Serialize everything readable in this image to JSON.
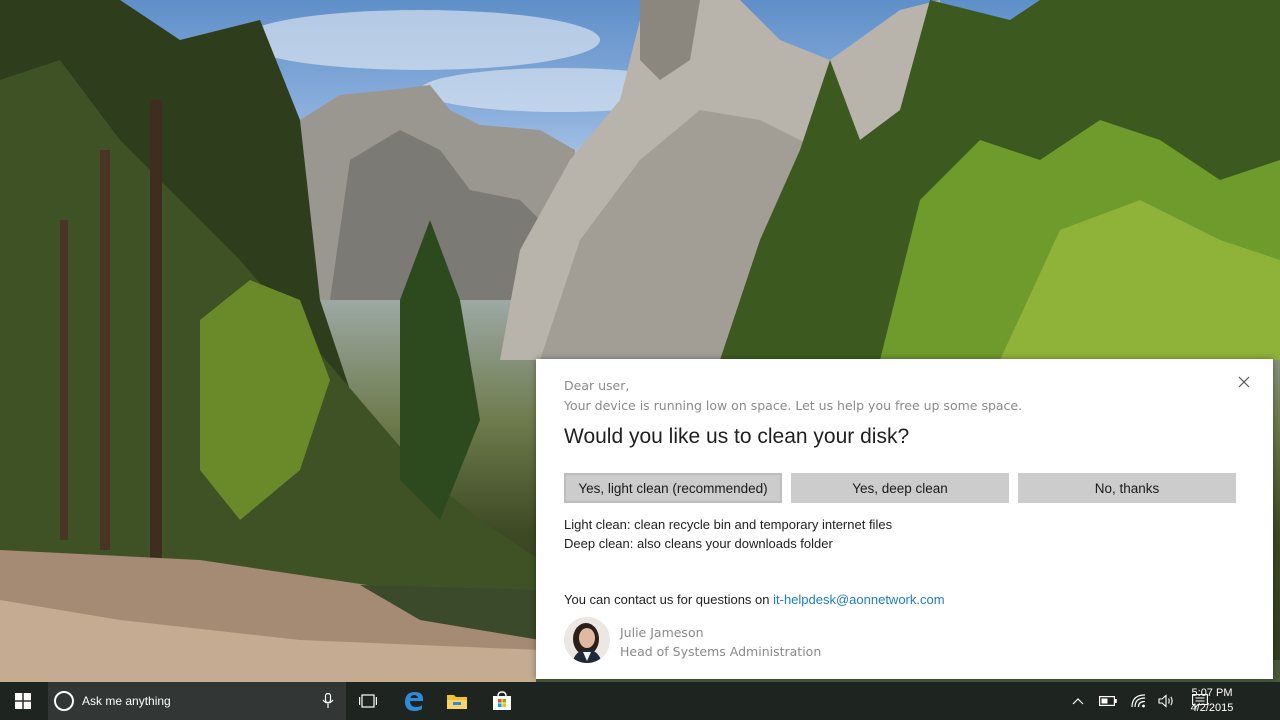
{
  "notification": {
    "greeting": "Dear user,",
    "subtext": "Your device is running low on space. Let us help you free up some space.",
    "question": "Would you like us to clean your disk?",
    "buttons": {
      "light": "Yes, light clean (recommended)",
      "deep": "Yes, deep clean",
      "no": "No, thanks"
    },
    "info_light": "Light clean: clean recycle bin and temporary internet files",
    "info_deep": "Deep clean: also cleans your downloads folder",
    "contact_prefix": "You can contact us for questions on ",
    "contact_email": "it-helpdesk@aonnetwork.com",
    "sender_name": "Julie Jameson",
    "sender_title": "Head of Systems Administration"
  },
  "taskbar": {
    "search_placeholder": "Ask me anything",
    "time": "5:07 PM",
    "date": "4/2/2015",
    "icons": [
      "windows-start-icon",
      "cortana-icon",
      "microphone-icon",
      "task-view-icon",
      "edge-browser-icon",
      "file-explorer-icon",
      "store-icon",
      "chevron-up-icon",
      "battery-icon",
      "wifi-icon",
      "volume-icon",
      "action-center-icon"
    ]
  },
  "colors": {
    "link": "#1e7cc8",
    "taskbar": "#1e2420",
    "button": "#cccccc",
    "edge": "#1e7cc8",
    "explorer": "#f2c12e"
  }
}
